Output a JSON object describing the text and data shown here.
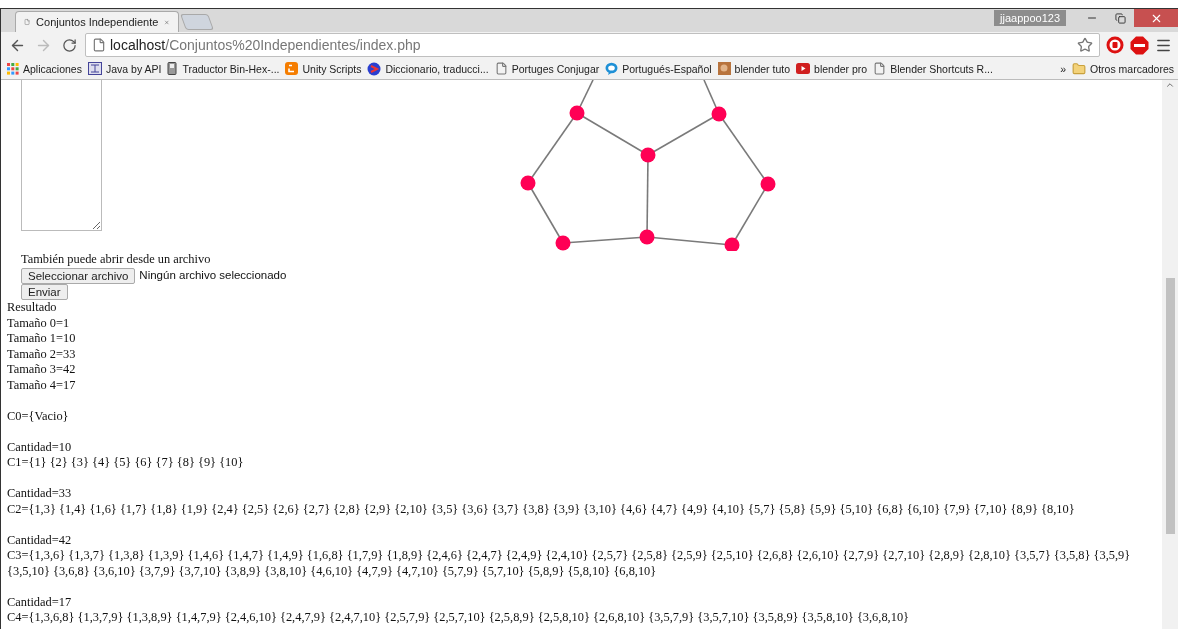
{
  "browser": {
    "tabs": [
      {
        "title": "Conjuntos Independiente",
        "selected": true
      }
    ],
    "profile": "jjaappoo123",
    "nav": {
      "back_enabled": true,
      "forward_enabled": false
    },
    "address": {
      "host": "localhost",
      "path": "/Conjuntos%20Independientes/index.php"
    },
    "bookmarks": [
      {
        "label": "Aplicaciones",
        "kind": "apps"
      },
      {
        "label": "Java by API",
        "kind": "java"
      },
      {
        "label": "Traductor Bin-Hex-...",
        "kind": "translator"
      },
      {
        "label": "Unity Scripts",
        "kind": "blogger"
      },
      {
        "label": "Diccionario, traducci...",
        "kind": "dictionary"
      },
      {
        "label": "Portuges Conjugar",
        "kind": "page"
      },
      {
        "label": "Portugués-Español",
        "kind": "chat"
      },
      {
        "label": "blender tuto",
        "kind": "image"
      },
      {
        "label": "blender pro",
        "kind": "video"
      },
      {
        "label": "Blender Shortcuts R...",
        "kind": "page"
      }
    ],
    "bookmarks_more": "»",
    "other_bookmarks": "Otros marcadores"
  },
  "page": {
    "file_prompt": "También puede abrir desde un archivo",
    "file_button": "Seleccionar archivo",
    "file_status": "Ningún archivo seleccionado",
    "submit": "Enviar",
    "result": {
      "title": "Resultado",
      "sizes": [
        "Tamaño 0=1",
        "Tamaño 1=10",
        "Tamaño 2=33",
        "Tamaño 3=42",
        "Tamaño 4=17"
      ],
      "empty_set": "C0={Vacio}",
      "groups": [
        {
          "count": "Cantidad=10",
          "sets": "C1={1} {2} {3} {4} {5} {6} {7} {8} {9} {10}"
        },
        {
          "count": "Cantidad=33",
          "sets": "C2={1,3} {1,4} {1,6} {1,7} {1,8} {1,9} {2,4} {2,5} {2,6} {2,7} {2,8} {2,9} {2,10} {3,5} {3,6} {3,7} {3,8} {3,9} {3,10} {4,6} {4,7} {4,9} {4,10} {5,7} {5,8} {5,9} {5,10} {6,8} {6,10} {7,9} {7,10} {8,9} {8,10}"
        },
        {
          "count": "Cantidad=42",
          "sets": "C3={1,3,6} {1,3,7} {1,3,8} {1,3,9} {1,4,6} {1,4,7} {1,4,9} {1,6,8} {1,7,9} {1,8,9} {2,4,6} {2,4,7} {2,4,9} {2,4,10} {2,5,7} {2,5,8} {2,5,9} {2,5,10} {2,6,8} {2,6,10} {2,7,9} {2,7,10} {2,8,9} {2,8,10} {3,5,7} {3,5,8} {3,5,9} {3,5,10} {3,6,8} {3,6,10} {3,7,9} {3,7,10} {3,8,9} {3,8,10} {4,6,10} {4,7,9} {4,7,10} {5,7,9} {5,7,10} {5,8,9} {5,8,10} {6,8,10}"
        },
        {
          "count": "Cantidad=17",
          "sets": "C4={1,3,6,8} {1,3,7,9} {1,3,8,9} {1,4,7,9} {2,4,6,10} {2,4,7,9} {2,4,7,10} {2,5,7,9} {2,5,7,10} {2,5,8,9} {2,5,8,10} {2,6,8,10} {3,5,7,9} {3,5,7,10} {3,5,8,9} {3,5,8,10} {3,6,8,10}"
        }
      ]
    }
  }
}
